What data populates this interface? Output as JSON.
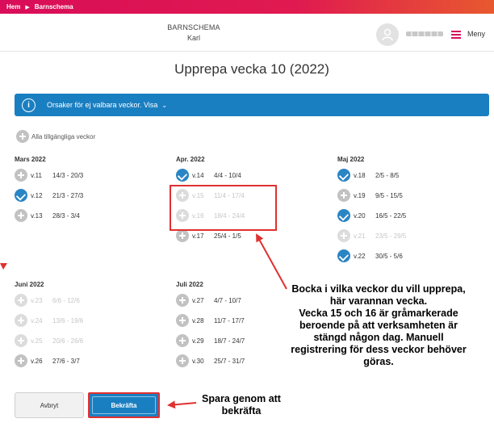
{
  "breadcrumb": {
    "home": "Hem",
    "current": "Barnschema"
  },
  "header": {
    "title": "BARNSCHEMA",
    "subtitle": "Karl",
    "menu_label": "Meny"
  },
  "page_title": "Upprepa vecka 10 (2022)",
  "info_bar": {
    "text": "Orsaker för ej valbara veckor. Visa",
    "chevron": "⌄"
  },
  "all_weeks_label": "Alla tillgängliga veckor",
  "months": [
    {
      "name": "Mars 2022",
      "weeks": [
        {
          "week": "v.11",
          "range": "14/3 - 20/3",
          "state": "available"
        },
        {
          "week": "v.12",
          "range": "21/3 - 27/3",
          "state": "checked"
        },
        {
          "week": "v.13",
          "range": "28/3 - 3/4",
          "state": "available"
        }
      ]
    },
    {
      "name": "Apr. 2022",
      "weeks": [
        {
          "week": "v.14",
          "range": "4/4 - 10/4",
          "state": "checked"
        },
        {
          "week": "v.15",
          "range": "11/4 - 17/4",
          "state": "disabled"
        },
        {
          "week": "v.16",
          "range": "18/4 - 24/4",
          "state": "disabled"
        },
        {
          "week": "v.17",
          "range": "25/4 - 1/5",
          "state": "available"
        }
      ]
    },
    {
      "name": "Maj 2022",
      "weeks": [
        {
          "week": "v.18",
          "range": "2/5 - 8/5",
          "state": "checked"
        },
        {
          "week": "v.19",
          "range": "9/5 - 15/5",
          "state": "available"
        },
        {
          "week": "v.20",
          "range": "16/5 - 22/5",
          "state": "checked"
        },
        {
          "week": "v.21",
          "range": "23/5 - 29/5",
          "state": "disabled"
        },
        {
          "week": "v.22",
          "range": "30/5 - 5/6",
          "state": "checked"
        }
      ]
    },
    {
      "name": "Juni 2022",
      "weeks": [
        {
          "week": "v.23",
          "range": "6/6 - 12/6",
          "state": "disabled"
        },
        {
          "week": "v.24",
          "range": "13/6 - 19/6",
          "state": "disabled"
        },
        {
          "week": "v.25",
          "range": "20/6 - 26/6",
          "state": "disabled"
        },
        {
          "week": "v.26",
          "range": "27/6 - 3/7",
          "state": "available"
        }
      ]
    },
    {
      "name": "Juli 2022",
      "weeks": [
        {
          "week": "v.27",
          "range": "4/7 - 10/7",
          "state": "available"
        },
        {
          "week": "v.28",
          "range": "11/7 - 17/7",
          "state": "available"
        },
        {
          "week": "v.29",
          "range": "18/7 - 24/7",
          "state": "available"
        },
        {
          "week": "v.30",
          "range": "25/7 - 31/7",
          "state": "available"
        }
      ]
    }
  ],
  "annotations": {
    "main": [
      "Bocka i vilka veckor du vill upprepa,",
      "här varannan vecka.",
      "Vecka 15 och 16 är gråmarkerade",
      "beroende på att verksamheten är",
      "stängd någon dag. Manuell",
      "registrering för dess veckor behöver",
      "göras."
    ],
    "save": [
      "Spara genom att",
      "bekräfta"
    ]
  },
  "buttons": {
    "cancel": "Avbryt",
    "confirm": "Bekräfta"
  },
  "colors": {
    "brand": "#d90d59",
    "primary": "#1a7fc1",
    "highlight": "#e03030",
    "disabled": "#c6c6c6"
  }
}
